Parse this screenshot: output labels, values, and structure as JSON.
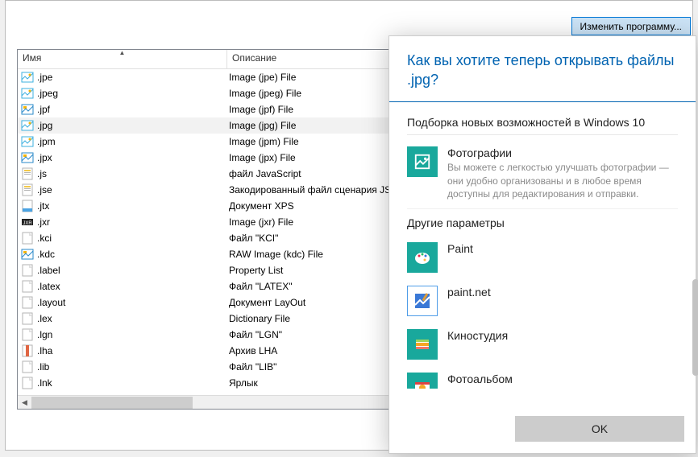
{
  "buttons": {
    "change_program": "Изменить программу...",
    "ok": "OK"
  },
  "columns": {
    "name": "Имя",
    "description": "Описание"
  },
  "rows": [
    {
      "ext": ".jpe",
      "desc": "Image (jpe) File",
      "icon": "image-icon"
    },
    {
      "ext": ".jpeg",
      "desc": "Image (jpeg) File",
      "icon": "image-icon"
    },
    {
      "ext": ".jpf",
      "desc": "Image (jpf) File",
      "icon": "image2-icon"
    },
    {
      "ext": ".jpg",
      "desc": "Image (jpg) File",
      "icon": "image-icon",
      "selected": true
    },
    {
      "ext": ".jpm",
      "desc": "Image (jpm) File",
      "icon": "image-icon"
    },
    {
      "ext": ".jpx",
      "desc": "Image (jpx) File",
      "icon": "image2-icon"
    },
    {
      "ext": ".js",
      "desc": "файл JavaScript",
      "icon": "js-icon"
    },
    {
      "ext": ".jse",
      "desc": "Закодированный файл сценария JScript",
      "icon": "js-icon"
    },
    {
      "ext": ".jtx",
      "desc": "Документ XPS",
      "icon": "xps-icon"
    },
    {
      "ext": ".jxr",
      "desc": "Image (jxr) File",
      "icon": "jxr-icon"
    },
    {
      "ext": ".kci",
      "desc": "Файл \"KCI\"",
      "icon": "blank-icon"
    },
    {
      "ext": ".kdc",
      "desc": "RAW Image (kdc) File",
      "icon": "image2-icon"
    },
    {
      "ext": ".label",
      "desc": "Property List",
      "icon": "blank-icon"
    },
    {
      "ext": ".latex",
      "desc": "Файл \"LATEX\"",
      "icon": "blank-icon"
    },
    {
      "ext": ".layout",
      "desc": "Документ LayOut",
      "icon": "blank-icon"
    },
    {
      "ext": ".lex",
      "desc": "Dictionary File",
      "icon": "blank-icon"
    },
    {
      "ext": ".lgn",
      "desc": "Файл \"LGN\"",
      "icon": "blank-icon"
    },
    {
      "ext": ".lha",
      "desc": "Архив LHA",
      "icon": "archive-icon"
    },
    {
      "ext": ".lib",
      "desc": "Файл \"LIB\"",
      "icon": "blank-icon"
    },
    {
      "ext": ".lnk",
      "desc": "Ярлык",
      "icon": "blank-icon"
    }
  ],
  "dialog": {
    "title": "Как вы хотите теперь открывать файлы .jpg?",
    "featured_heading": "Подборка новых возможностей в Windows 10",
    "featured": {
      "name": "Фотографии",
      "desc": "Вы можете с легкостью улучшать фотографии — они удобно организованы и в любое время доступны для редактирования и отправки."
    },
    "other_heading": "Другие параметры",
    "apps": [
      {
        "name": "Paint",
        "icon": "paint-icon"
      },
      {
        "name": "paint.net",
        "icon": "paintnet-icon"
      },
      {
        "name": "Киностудия",
        "icon": "moviemaker-icon"
      },
      {
        "name": "Фотоальбом",
        "icon": "photoalbum-icon"
      }
    ]
  }
}
